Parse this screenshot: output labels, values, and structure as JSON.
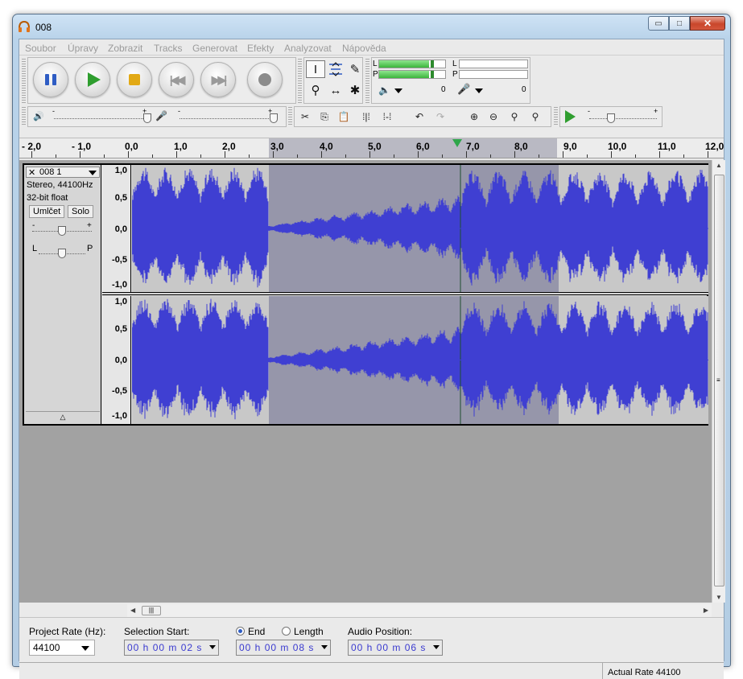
{
  "window": {
    "title": "008"
  },
  "menu": [
    "Soubor",
    "Úpravy",
    "Zobrazit",
    "Tracks",
    "Generovat",
    "Efekty",
    "Analyzovat",
    "Nápověda"
  ],
  "meters": {
    "play_left": "L",
    "play_right": "P",
    "rec_left": "L",
    "rec_right": "P",
    "play_value": "0",
    "rec_value": "0"
  },
  "ruler": {
    "labels": [
      "- 2,0",
      "- 1,0",
      "0,0",
      "1,0",
      "2,0",
      "3,0",
      "4,0",
      "5,0",
      "6,0",
      "7,0",
      "8,0",
      "9,0",
      "10,0",
      "11,0",
      "12,0"
    ]
  },
  "track": {
    "name": "008 1",
    "close": "✕",
    "info_format": "Stereo, 44100Hz",
    "info_bits": "32-bit float",
    "mute_label": "Umlčet",
    "solo_label": "Solo",
    "gain_minus": "-",
    "gain_plus": "+",
    "pan_left": "L",
    "pan_right": "P",
    "collapse_icon": "△",
    "channel_scale": [
      "1,0",
      "0,5",
      "0,0",
      "-0,5",
      "-1,0"
    ]
  },
  "selection_bar": {
    "rate_label": "Project Rate (Hz):",
    "rate_value": "44100",
    "sel_start_label": "Selection Start:",
    "end_label": "End",
    "length_label": "Length",
    "audio_pos_label": "Audio Position:",
    "sel_start_value": "00 h 00 m 02 s",
    "end_value": "00 h 00 m 08 s",
    "audio_pos_value": "00 h 00 m 06 s"
  },
  "status": {
    "actual_rate": "Actual Rate 44100"
  },
  "colors": {
    "wave": "#3f3fd2",
    "selection": "#9696aa",
    "accent": "#2f5dc4"
  }
}
